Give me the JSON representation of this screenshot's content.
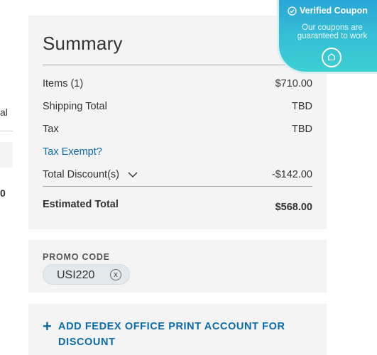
{
  "left_column": {
    "fragment_text": "al",
    "fragment_number": "0"
  },
  "summary": {
    "title": "Summary",
    "rows": [
      {
        "label": "Items (1)",
        "value": "$710.00"
      },
      {
        "label": "Shipping Total",
        "value": "TBD"
      },
      {
        "label": "Tax",
        "value": "TBD"
      },
      {
        "label": "Tax Exempt?",
        "value": ""
      },
      {
        "label": "Total Discount(s)",
        "value": "-$142.00"
      }
    ],
    "total": {
      "label": "Estimated Total",
      "value": "$568.00"
    }
  },
  "promo": {
    "label": "PROMO CODE",
    "code": "USI220",
    "remove_symbol": "x"
  },
  "fedex": {
    "plus": "+",
    "link_text": "ADD FEDEX OFFICE PRINT ACCOUNT FOR DISCOUNT"
  },
  "verified_badge": {
    "title": "Verified Coupon",
    "subtitle": "Our coupons are guaranteed to work"
  },
  "colors": {
    "link_blue": "#0a6aa8",
    "card_bg": "#f4f4f4",
    "badge_gradient_start": "#2a9fd6",
    "badge_gradient_end": "#3dcfd3"
  },
  "icons": [
    "chevron-down-icon",
    "close-icon",
    "check-circle-icon",
    "coupon-badge-icon"
  ]
}
